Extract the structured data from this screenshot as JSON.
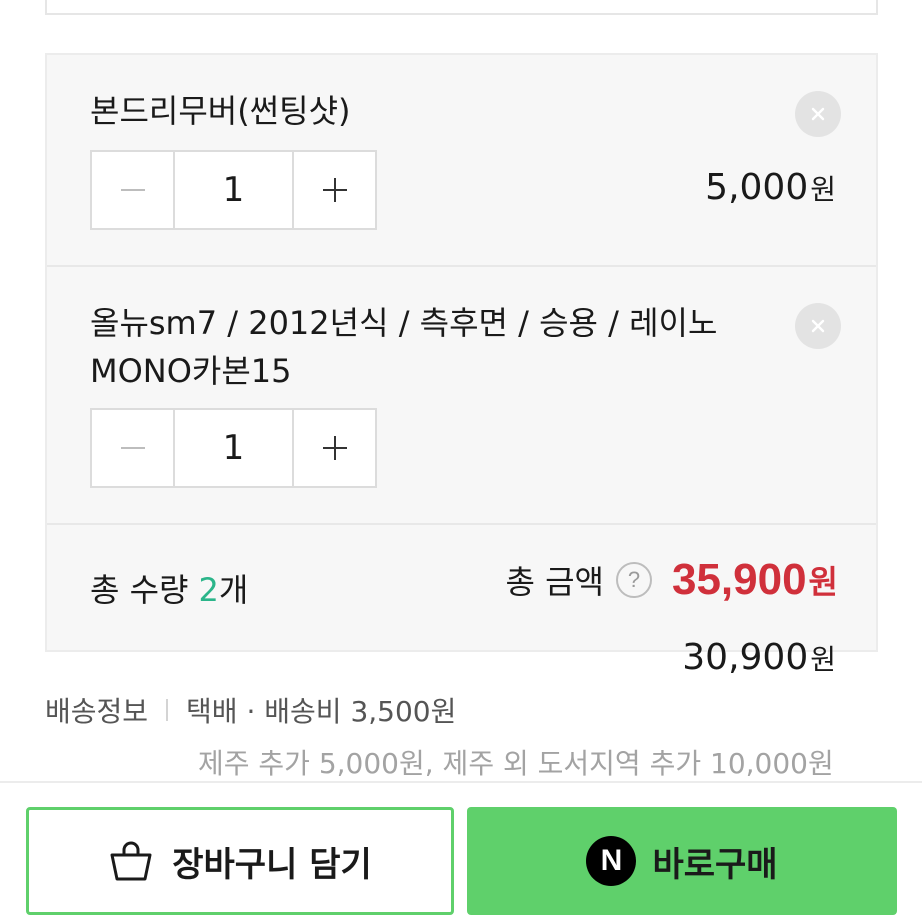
{
  "options": [
    {
      "name": "본드리무버(썬팅샷)",
      "quantity": "1",
      "price": "5,000",
      "currency": "원"
    },
    {
      "name": "올뉴sm7 / 2012년식 / 측후면 / 승용 / 레이노 MONO카본15",
      "quantity": "1",
      "price": "30,900",
      "currency": "원"
    }
  ],
  "totals": {
    "qty_label": "총 수량",
    "qty_value": "2",
    "qty_unit": "개",
    "amount_label": "총 금액",
    "help_symbol": "?",
    "amount_value": "35,900",
    "amount_currency": "원"
  },
  "shipping": {
    "label": "배송정보",
    "value": "택배 · 배송비 3,500원",
    "extra": "제주 추가 5,000원, 제주 외 도서지역 추가 10,000원"
  },
  "actions": {
    "cart_label": "장바구니 담기",
    "buy_label": "바로구매",
    "npay_letter": "N"
  },
  "colors": {
    "accent_green": "#5fd06b",
    "total_price_red": "#d0303b",
    "qty_highlight": "#2bb58a"
  },
  "icons": {
    "remove": "close-icon",
    "minus": "minus-icon",
    "plus": "plus-icon",
    "help": "question-icon",
    "cart": "shopping-bag-icon",
    "npay": "naver-pay-icon"
  }
}
